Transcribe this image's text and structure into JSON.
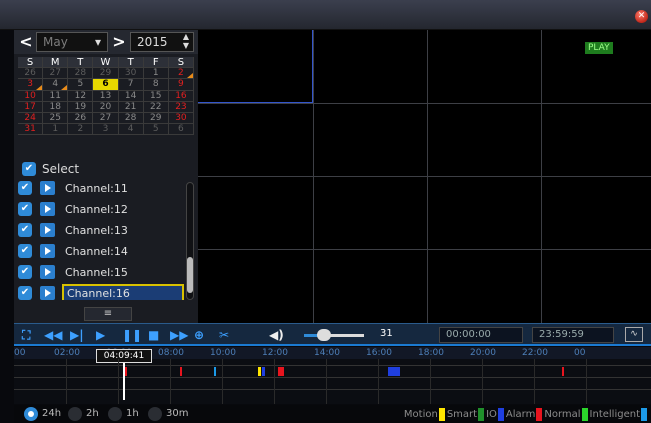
{
  "window": {
    "close_icon": "close-icon"
  },
  "calendar": {
    "prev": "<",
    "month": "May",
    "month_arrow": "▾",
    "next": ">",
    "year": "2015",
    "weekdays": [
      "S",
      "M",
      "T",
      "W",
      "T",
      "F",
      "S"
    ],
    "weeks": [
      [
        "26",
        "27",
        "28",
        "29",
        "30",
        "1",
        "2"
      ],
      [
        "3",
        "4",
        "5",
        "6",
        "7",
        "8",
        "9"
      ],
      [
        "10",
        "11",
        "12",
        "13",
        "14",
        "15",
        "16"
      ],
      [
        "17",
        "18",
        "19",
        "20",
        "21",
        "22",
        "23"
      ],
      [
        "24",
        "25",
        "26",
        "27",
        "28",
        "29",
        "30"
      ],
      [
        "31",
        "1",
        "2",
        "3",
        "4",
        "5",
        "6"
      ]
    ],
    "selected_day": "6"
  },
  "select": {
    "label": "Select"
  },
  "channels": [
    "Channel:11",
    "Channel:12",
    "Channel:13",
    "Channel:14",
    "Channel:15",
    "Channel:16"
  ],
  "active_channel": "Channel:16",
  "menu_button": "≡",
  "video": {
    "status_label": "PLAY"
  },
  "controls": {
    "volume": "31",
    "start_time": "00:00:00",
    "end_time": "23:59:59",
    "volume_level_percent": 40
  },
  "timeline": {
    "ticks": [
      "00",
      "02:00",
      "06:00",
      "08:00",
      "10:00",
      "12:00",
      "14:00",
      "16:00",
      "18:00",
      "20:00",
      "22:00",
      "00"
    ],
    "cursor_time": "04:09:41"
  },
  "zoom_options": [
    "24h",
    "2h",
    "1h",
    "30m"
  ],
  "legend": [
    {
      "label": "Motion",
      "color": "#ffe600"
    },
    {
      "label": "Smart",
      "color": "#1f8f2b"
    },
    {
      "label": "IO",
      "color": "#1f3fe0"
    },
    {
      "label": "Alarm",
      "color": "#e8141e"
    },
    {
      "label": "Normal",
      "color": "#2bd62b"
    },
    {
      "label": "Intelligent",
      "color": "#1c9ae8"
    }
  ]
}
